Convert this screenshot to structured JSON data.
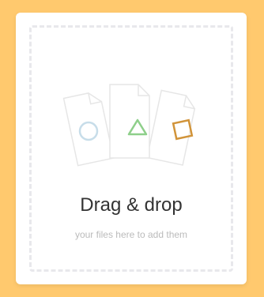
{
  "colors": {
    "background": "#FFC96E",
    "card": "#FFFFFF",
    "dashed_border": "#E8E8EC",
    "circle_icon": "#C7DDE9",
    "triangle_icon": "#8ECF8A",
    "square_icon": "#D1943A",
    "doc_outline": "#E6E6E6"
  },
  "dropzone": {
    "title": "Drag & drop",
    "subtitle": "your files here to add them"
  },
  "illustration": {
    "documents": [
      {
        "icon": "circle-icon"
      },
      {
        "icon": "triangle-icon"
      },
      {
        "icon": "square-icon"
      }
    ]
  }
}
